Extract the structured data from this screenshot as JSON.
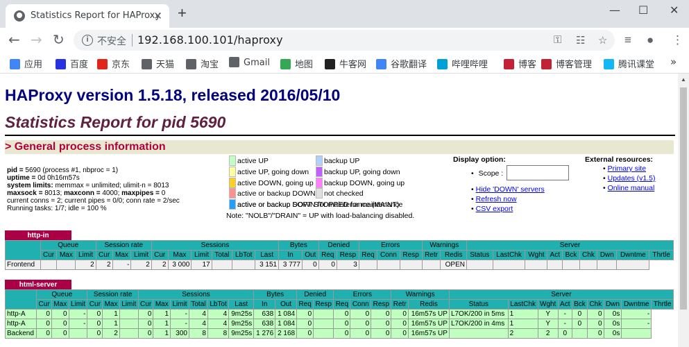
{
  "browser": {
    "tab_title": "Statistics Report for HAProxy",
    "tab_close": "✕",
    "new_tab": "+",
    "insecure_label": "不安全",
    "url": "192.168.100.101/haproxy"
  },
  "bookmarks": [
    {
      "label": "应用",
      "icon": "apps-grid-icon",
      "color": "#4285f4"
    },
    {
      "label": "百度",
      "icon": "baidu-icon",
      "color": "#2932e1"
    },
    {
      "label": "京东",
      "icon": "jd-icon",
      "color": "#e1251b"
    },
    {
      "label": "天猫",
      "icon": "globe-icon",
      "color": "#5f6368"
    },
    {
      "label": "淘宝",
      "icon": "globe-icon",
      "color": "#5f6368"
    },
    {
      "label": "Gmail",
      "icon": "globe-icon",
      "color": "#5f6368"
    },
    {
      "label": "地图",
      "icon": "maps-icon",
      "color": "#34a853"
    },
    {
      "label": "牛客网",
      "icon": "nowcoder-icon",
      "color": "#222222"
    },
    {
      "label": "谷歌翻译",
      "icon": "translate-icon",
      "color": "#4285f4"
    },
    {
      "label": "哔哩哔哩",
      "icon": "bilibili-icon",
      "color": "#00a1d6"
    },
    {
      "label": "博客",
      "icon": "csdn-icon",
      "color": "#c32136"
    },
    {
      "label": "博客管理",
      "icon": "csdn-icon",
      "color": "#c32136"
    },
    {
      "label": "腾讯课堂",
      "icon": "tencent-icon",
      "color": "#12b7f5"
    }
  ],
  "bookmarks_more": "»",
  "page": {
    "title": "HAProxy version 1.5.18, released 2016/05/10",
    "subtitle": "Statistics Report for pid 5690",
    "section": "> General process information",
    "pinfo": {
      "line1_k": "pid = ",
      "line1_v": "5690 (process #1, nbproc = 1)",
      "line2_k": "uptime = ",
      "line2_v": "0d 0h16m57s",
      "line3_k": "system limits:",
      "line3_v": " memmax = unlimited; ulimit-n = 8013",
      "line4_k1": "maxsock = ",
      "line4_v1": "8013; ",
      "line4_k2": "maxconn = ",
      "line4_v2": "4000; ",
      "line4_k3": "maxpipes = ",
      "line4_v3": "0",
      "line5": "current conns = 2; current pipes = 0/0; conn rate = 2/sec",
      "line6": "Running tasks: 1/7; idle = 100 %"
    },
    "legend": [
      {
        "label": "active UP",
        "color": "#c0ffc0"
      },
      {
        "label": "backup UP",
        "color": "#b0d0ff"
      },
      {
        "label": "active UP, going down",
        "color": "#ffffa0"
      },
      {
        "label": "backup UP, going down",
        "color": "#c060ff"
      },
      {
        "label": "active DOWN, going up",
        "color": "#ffd020"
      },
      {
        "label": "backup DOWN, going up",
        "color": "#ff80ff"
      },
      {
        "label": "active or backup DOWN",
        "color": "#ff9090"
      },
      {
        "label": "not checked",
        "color": "#e0e0e0"
      },
      {
        "label": "active or backup DOWN for maintenance (MAINT)",
        "color": "#c07820"
      },
      {
        "label": "active or backup SOFT STOPPED for maintenance",
        "color": "#20a0ff"
      }
    ],
    "legend_note": "Note: \"NOLB\"/\"DRAIN\" = UP with load-balancing disabled.",
    "display": {
      "title": "Display option:",
      "scope_label": "Scope :",
      "hide_down": "Hide 'DOWN' servers",
      "refresh": "Refresh now",
      "csv": "CSV export"
    },
    "external": {
      "title": "External resources:",
      "primary": "Primary site",
      "updates": "Updates (v1.5)",
      "manual": "Online manual"
    }
  },
  "tables": {
    "group_headers": [
      "Queue",
      "Session rate",
      "Sessions",
      "Bytes",
      "Denied",
      "Errors",
      "Warnings",
      "Server"
    ],
    "sub_headers": [
      "Cur",
      "Max",
      "Limit",
      "Cur",
      "Max",
      "Limit",
      "Cur",
      "Max",
      "Limit",
      "Total",
      "LbTot",
      "Last",
      "In",
      "Out",
      "Req",
      "Resp",
      "Req",
      "Conn",
      "Resp",
      "Retr",
      "Redis",
      "Status",
      "LastChk",
      "Wght",
      "Act",
      "Bck",
      "Chk",
      "Dwn",
      "Dwntme",
      "Thrtle"
    ],
    "http_in": {
      "name": "http-in",
      "rows": [
        [
          "Frontend",
          "",
          "",
          "",
          "2",
          "2",
          "-",
          "2",
          "2",
          "3 000",
          "17",
          "",
          "",
          "3 151",
          "3 777",
          "0",
          "0",
          "3",
          "",
          "",
          "",
          "",
          "OPEN",
          "",
          "",
          "",
          "",
          "",
          "",
          "",
          ""
        ]
      ]
    },
    "html_server": {
      "name": "html-server",
      "rows": [
        [
          "http-A",
          "0",
          "0",
          "-",
          "0",
          "1",
          "",
          "0",
          "1",
          "-",
          "4",
          "4",
          "9m25s",
          "638",
          "1 084",
          "",
          "0",
          "",
          "0",
          "0",
          "0",
          "0",
          "16m57s UP",
          "L7OK/200 in 5ms",
          "1",
          "Y",
          "-",
          "0",
          "0",
          "0s",
          "-"
        ],
        [
          "http-A",
          "0",
          "0",
          "-",
          "0",
          "1",
          "",
          "0",
          "1",
          "-",
          "4",
          "4",
          "9m25s",
          "638",
          "1 084",
          "",
          "0",
          "",
          "0",
          "0",
          "0",
          "0",
          "16m57s UP",
          "L7OK/200 in 4ms",
          "1",
          "Y",
          "-",
          "0",
          "0",
          "0s",
          "-"
        ],
        [
          "Backend",
          "0",
          "0",
          "",
          "0",
          "2",
          "",
          "0",
          "1",
          "300",
          "8",
          "8",
          "9m25s",
          "1 276",
          "2 168",
          "0",
          "0",
          "",
          "0",
          "0",
          "0",
          "0",
          "16m57s UP",
          "",
          "2",
          "2",
          "0",
          "",
          "0",
          "0s",
          ""
        ]
      ]
    }
  },
  "colors": {
    "title": "#000080",
    "subtitle": "#602040",
    "section": "#b00040",
    "table_header": "#20b0b0",
    "proxy_label": "#aa0046",
    "row_up": "#c0ffc0",
    "row_frontend": "#f0f0f0"
  }
}
